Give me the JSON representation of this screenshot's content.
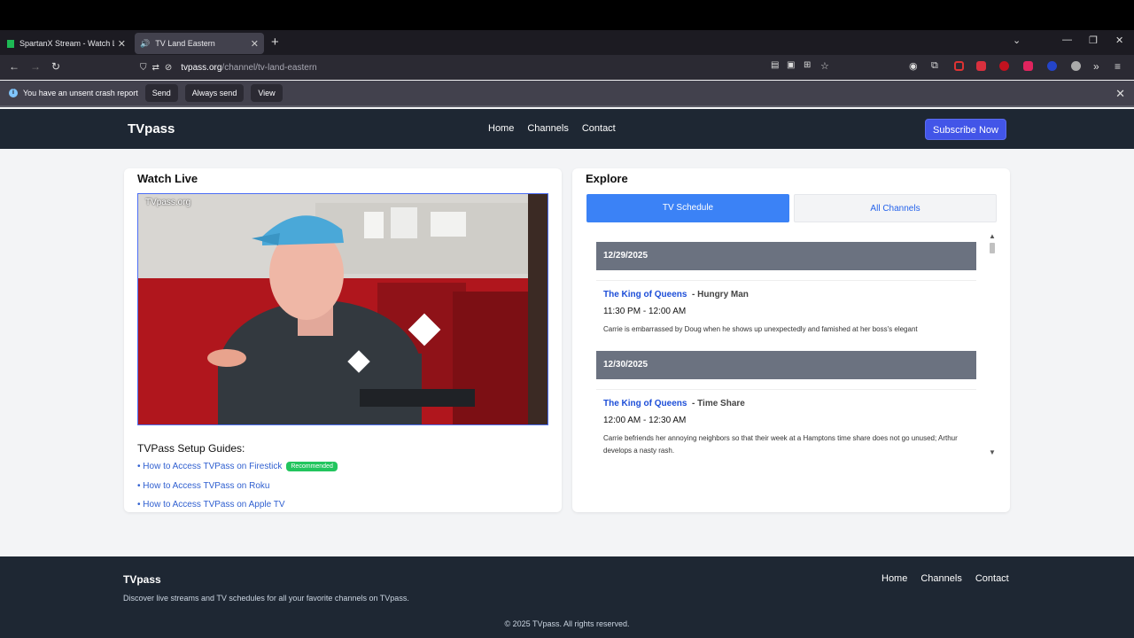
{
  "browser": {
    "tabs": [
      {
        "title": "SpartanX Stream - Watch Live o"
      },
      {
        "title": "TV Land Eastern"
      }
    ],
    "url_host": "tvpass.org",
    "url_path": "/channel/tv-land-eastern",
    "crash_bar": {
      "message": "You have an unsent crash report",
      "buttons": [
        "Send",
        "Always send",
        "View"
      ]
    }
  },
  "site": {
    "logo": "TVpass",
    "nav": [
      "Home",
      "Channels",
      "Contact"
    ],
    "subscribe": "Subscribe Now"
  },
  "watch": {
    "title": "Watch Live",
    "watermark": "TVpass.org",
    "guides_title": "TVPass Setup Guides:",
    "guides": [
      "• How to Access TVPass on Firestick",
      "• How to Access TVPass on Roku",
      "• How to Access TVPass on Apple TV"
    ],
    "badge": "Recommended"
  },
  "explore": {
    "title": "Explore",
    "tabs": [
      "TV Schedule",
      "All Channels"
    ],
    "schedule": [
      {
        "date": "12/29/2025",
        "show": "The King of Queens",
        "episode": "- Hungry Man",
        "time": "11:30 PM - 12:00 AM",
        "desc": "Carrie is embarrassed by Doug when he shows up unexpectedly and famished at her boss's elegant"
      },
      {
        "date": "12/30/2025",
        "show": "The King of Queens",
        "episode": "- Time Share",
        "time": "12:00 AM - 12:30 AM",
        "desc": "Carrie befriends her annoying neighbors so that their week at a Hamptons time share does not go unused; Arthur develops a nasty rash."
      }
    ]
  },
  "footer": {
    "logo": "TVpass",
    "desc": "Discover live streams and TV schedules for all your favorite channels on TVpass.",
    "nav": [
      "Home",
      "Channels",
      "Contact"
    ],
    "copyright": "© 2025 TVpass. All rights reserved."
  }
}
